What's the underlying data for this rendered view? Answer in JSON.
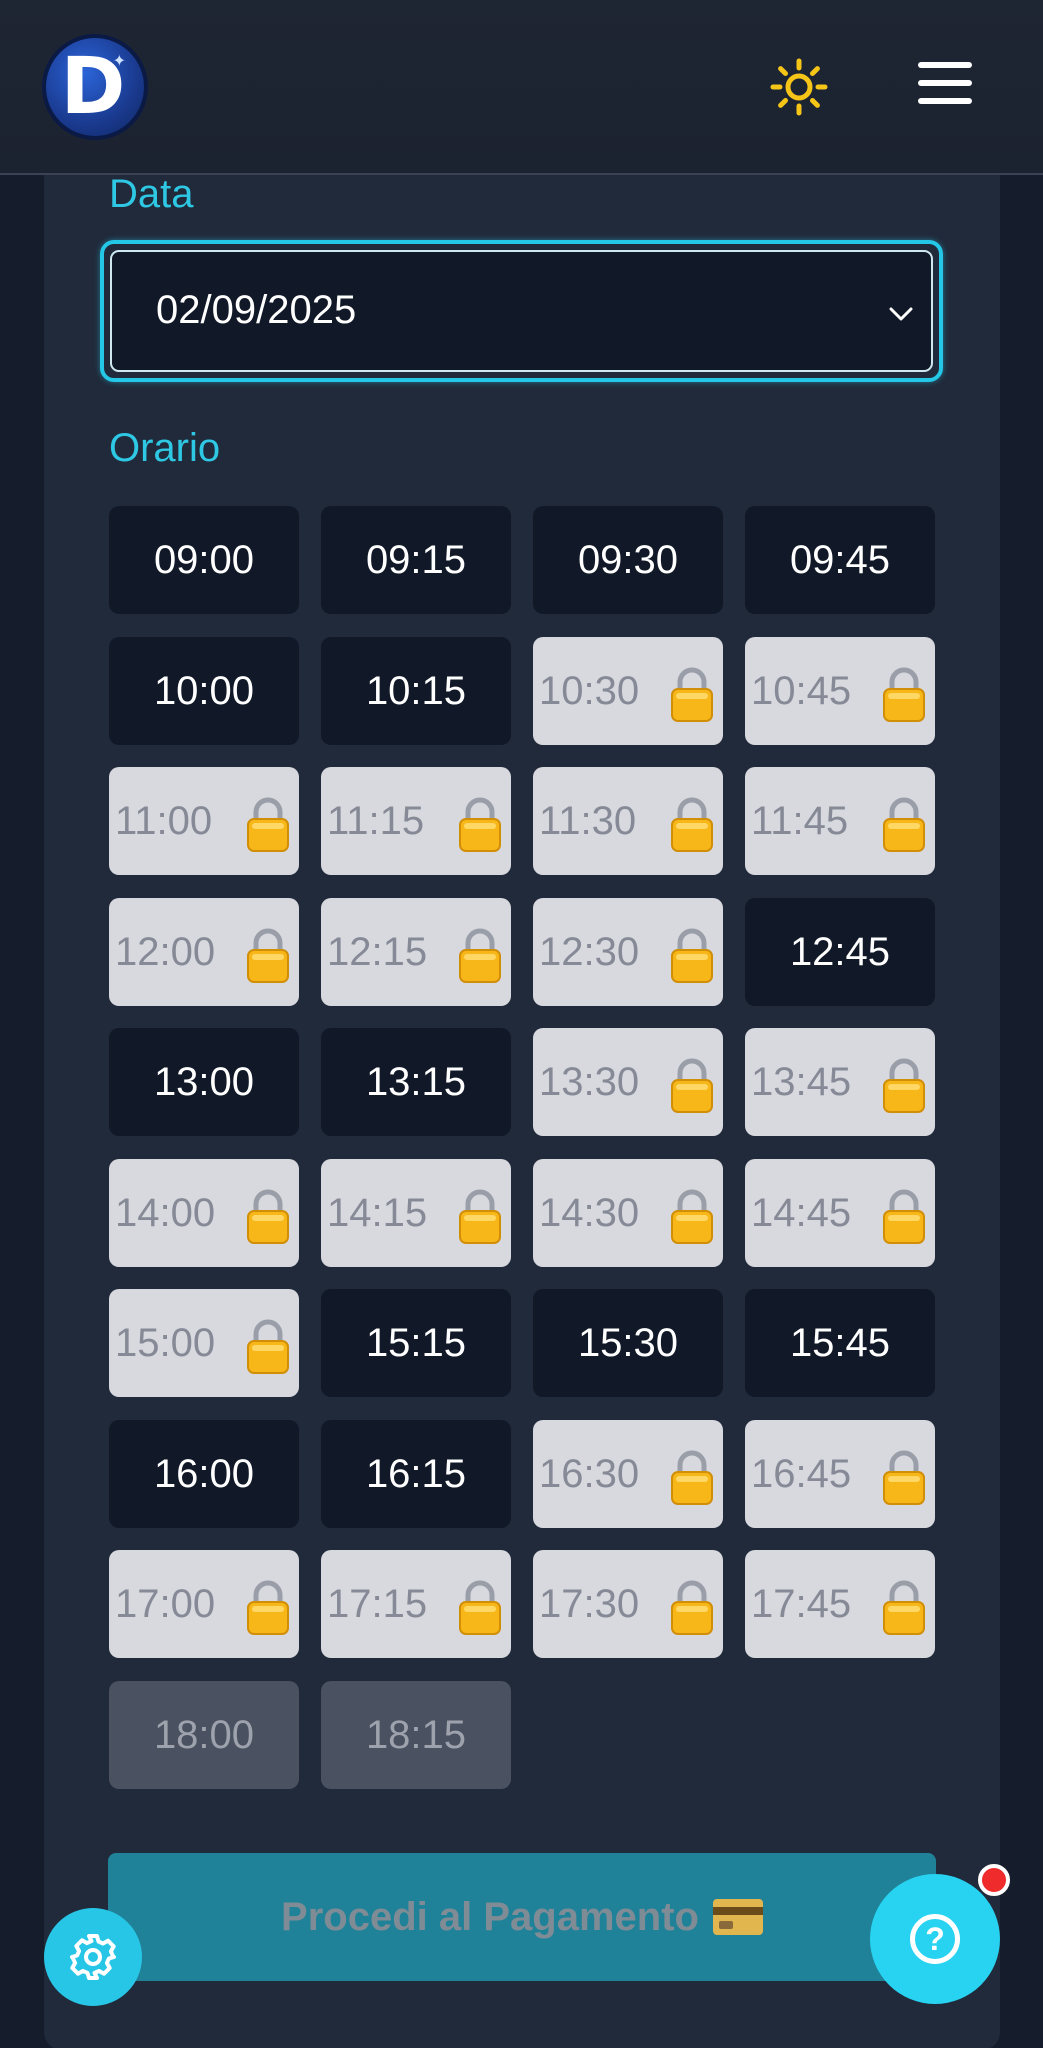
{
  "header": {
    "logo_letter": "D",
    "theme_icon": "sun-icon",
    "menu_icon": "hamburger-menu-icon"
  },
  "form": {
    "date_label": "Data",
    "date_value": "02/09/2025",
    "time_label": "Orario"
  },
  "slots": [
    {
      "time": "09:00",
      "status": "available"
    },
    {
      "time": "09:15",
      "status": "available"
    },
    {
      "time": "09:30",
      "status": "available"
    },
    {
      "time": "09:45",
      "status": "available"
    },
    {
      "time": "10:00",
      "status": "available"
    },
    {
      "time": "10:15",
      "status": "available"
    },
    {
      "time": "10:30",
      "status": "locked"
    },
    {
      "time": "10:45",
      "status": "locked"
    },
    {
      "time": "11:00",
      "status": "locked"
    },
    {
      "time": "11:15",
      "status": "locked"
    },
    {
      "time": "11:30",
      "status": "locked"
    },
    {
      "time": "11:45",
      "status": "locked"
    },
    {
      "time": "12:00",
      "status": "locked"
    },
    {
      "time": "12:15",
      "status": "locked"
    },
    {
      "time": "12:30",
      "status": "locked"
    },
    {
      "time": "12:45",
      "status": "available"
    },
    {
      "time": "13:00",
      "status": "available"
    },
    {
      "time": "13:15",
      "status": "available"
    },
    {
      "time": "13:30",
      "status": "locked"
    },
    {
      "time": "13:45",
      "status": "locked"
    },
    {
      "time": "14:00",
      "status": "locked"
    },
    {
      "time": "14:15",
      "status": "locked"
    },
    {
      "time": "14:30",
      "status": "locked"
    },
    {
      "time": "14:45",
      "status": "locked"
    },
    {
      "time": "15:00",
      "status": "locked"
    },
    {
      "time": "15:15",
      "status": "available"
    },
    {
      "time": "15:30",
      "status": "available"
    },
    {
      "time": "15:45",
      "status": "available"
    },
    {
      "time": "16:00",
      "status": "available"
    },
    {
      "time": "16:15",
      "status": "available"
    },
    {
      "time": "16:30",
      "status": "locked"
    },
    {
      "time": "16:45",
      "status": "locked"
    },
    {
      "time": "17:00",
      "status": "locked"
    },
    {
      "time": "17:15",
      "status": "locked"
    },
    {
      "time": "17:30",
      "status": "locked"
    },
    {
      "time": "17:45",
      "status": "locked"
    },
    {
      "time": "18:00",
      "status": "disabled"
    },
    {
      "time": "18:15",
      "status": "disabled"
    }
  ],
  "actions": {
    "proceed_label": "Procedi al Pagamento",
    "proceed_icon": "credit-card-icon",
    "settings_icon": "gear-icon",
    "help_icon": "question-icon",
    "help_glyph": "?"
  },
  "colors": {
    "accent": "#27c6e6",
    "available_bg": "#111827",
    "locked_bg": "#d8d9df",
    "disabled_bg": "#4a5160",
    "notification": "#ef2b2b"
  }
}
